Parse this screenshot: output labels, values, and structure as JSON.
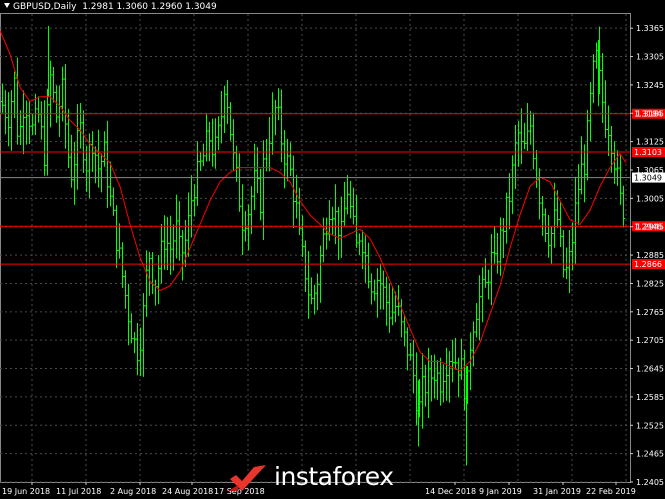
{
  "header": {
    "symbol": "GBPUSD,Daily",
    "ohlc": "1.2981 1.3060 1.2960 1.3049"
  },
  "price_axis": {
    "ticks": [
      "1.3365",
      "1.3305",
      "1.3245",
      "1.3185",
      "1.3125",
      "1.3065",
      "1.3005",
      "1.2945",
      "1.2885",
      "1.2825",
      "1.2765",
      "1.2705",
      "1.2645",
      "1.2585",
      "1.2525",
      "1.2465",
      "1.2405"
    ]
  },
  "time_axis": {
    "labels": [
      "19 Jun 2018",
      "11 Jul 2018",
      "2 Aug 2018",
      "24 Aug 2018",
      "17 Sep 2018",
      "14 Dec 2018",
      "9 Jan 2019",
      "31 Jan 2019",
      "22 Feb 2019"
    ]
  },
  "horizontal_levels": [
    {
      "price": 1.3184,
      "label": "1.3184"
    },
    {
      "price": 1.3103,
      "label": "1.3103"
    },
    {
      "price": 1.2946,
      "label": "1.2946"
    },
    {
      "price": 1.2866,
      "label": "1.2866"
    }
  ],
  "current_price": {
    "price": 1.3049,
    "label": "1.3049"
  },
  "watermark": {
    "text": "instaforex",
    "icon": "instaforex-logo-icon"
  },
  "colors": {
    "background": "#000000",
    "grid": "#4a4a4a",
    "bar": "#00ff00",
    "moving_average": "#ff0000",
    "level_line": "#ff0000",
    "level_label_bg": "#ff0000",
    "current_label_bg": "#ffffff",
    "axis_text": "#ffffff",
    "watermark_logo": "#e8362d"
  },
  "chart_data": {
    "type": "ohlc",
    "instrument": "GBPUSD",
    "timeframe": "Daily",
    "price_range": [
      1.2405,
      1.3395
    ],
    "close_path": [
      [
        0,
        1.321
      ],
      [
        8,
        1.318
      ],
      [
        14,
        1.325
      ],
      [
        18,
        1.312
      ],
      [
        24,
        1.322
      ],
      [
        32,
        1.315
      ],
      [
        38,
        1.318
      ],
      [
        44,
        1.31
      ],
      [
        50,
        1.326
      ],
      [
        56,
        1.318
      ],
      [
        62,
        1.323
      ],
      [
        66,
        1.314
      ],
      [
        70,
        1.305
      ],
      [
        76,
        1.311
      ],
      [
        80,
        1.315
      ],
      [
        86,
        1.308
      ],
      [
        92,
        1.313
      ],
      [
        98,
        1.307
      ],
      [
        104,
        1.31
      ],
      [
        110,
        1.3
      ],
      [
        116,
        1.292
      ],
      [
        122,
        1.284
      ],
      [
        128,
        1.276
      ],
      [
        134,
        1.27
      ],
      [
        138,
        1.268
      ],
      [
        144,
        1.278
      ],
      [
        148,
        1.29
      ],
      [
        154,
        1.282
      ],
      [
        158,
        1.286
      ],
      [
        164,
        1.292
      ],
      [
        170,
        1.29
      ],
      [
        176,
        1.294
      ],
      [
        180,
        1.288
      ],
      [
        186,
        1.292
      ],
      [
        192,
        1.302
      ],
      [
        198,
        1.306
      ],
      [
        204,
        1.31
      ],
      [
        208,
        1.314
      ],
      [
        214,
        1.31
      ],
      [
        220,
        1.316
      ],
      [
        224,
        1.325
      ],
      [
        228,
        1.32
      ],
      [
        232,
        1.31
      ],
      [
        238,
        1.302
      ],
      [
        242,
        1.296
      ],
      [
        248,
        1.298
      ],
      [
        254,
        1.304
      ],
      [
        260,
        1.3
      ],
      [
        264,
        1.31
      ],
      [
        270,
        1.315
      ],
      [
        276,
        1.32
      ],
      [
        280,
        1.314
      ],
      [
        284,
        1.31
      ],
      [
        290,
        1.306
      ],
      [
        296,
        1.298
      ],
      [
        300,
        1.29
      ],
      [
        306,
        1.284
      ],
      [
        310,
        1.278
      ],
      [
        316,
        1.282
      ],
      [
        320,
        1.288
      ],
      [
        326,
        1.296
      ],
      [
        330,
        1.3
      ],
      [
        336,
        1.296
      ],
      [
        342,
        1.292
      ],
      [
        346,
        1.304
      ],
      [
        350,
        1.298
      ],
      [
        356,
        1.29
      ],
      [
        360,
        1.294
      ],
      [
        366,
        1.287
      ],
      [
        372,
        1.282
      ],
      [
        378,
        1.284
      ],
      [
        384,
        1.28
      ],
      [
        390,
        1.276
      ],
      [
        396,
        1.278
      ],
      [
        402,
        1.272
      ],
      [
        408,
        1.268
      ],
      [
        414,
        1.262
      ],
      [
        418,
        1.255
      ],
      [
        422,
        1.26
      ],
      [
        428,
        1.262
      ],
      [
        434,
        1.264
      ],
      [
        440,
        1.262
      ],
      [
        444,
        1.265
      ],
      [
        450,
        1.268
      ],
      [
        456,
        1.266
      ],
      [
        462,
        1.264
      ],
      [
        466,
        1.258
      ],
      [
        470,
        1.27
      ],
      [
        474,
        1.276
      ],
      [
        480,
        1.28
      ],
      [
        486,
        1.282
      ],
      [
        490,
        1.288
      ],
      [
        494,
        1.286
      ],
      [
        500,
        1.292
      ],
      [
        504,
        1.296
      ],
      [
        510,
        1.302
      ],
      [
        514,
        1.31
      ],
      [
        518,
        1.314
      ],
      [
        522,
        1.31
      ],
      [
        526,
        1.312
      ],
      [
        530,
        1.316
      ],
      [
        536,
        1.306
      ],
      [
        540,
        1.3
      ],
      [
        546,
        1.294
      ],
      [
        550,
        1.292
      ],
      [
        556,
        1.298
      ],
      [
        560,
        1.29
      ],
      [
        564,
        1.284
      ],
      [
        568,
        1.286
      ],
      [
        572,
        1.292
      ],
      [
        576,
        1.3
      ],
      [
        580,
        1.306
      ],
      [
        584,
        1.308
      ],
      [
        588,
        1.316
      ],
      [
        592,
        1.326
      ],
      [
        596,
        1.33
      ],
      [
        600,
        1.324
      ],
      [
        604,
        1.318
      ],
      [
        608,
        1.316
      ],
      [
        612,
        1.312
      ],
      [
        616,
        1.306
      ],
      [
        620,
        1.3
      ],
      [
        624,
        1.298
      ]
    ],
    "moving_average_path": [
      [
        0,
        1.336
      ],
      [
        10,
        1.331
      ],
      [
        20,
        1.324
      ],
      [
        30,
        1.321
      ],
      [
        40,
        1.322
      ],
      [
        50,
        1.322
      ],
      [
        60,
        1.32
      ],
      [
        70,
        1.317
      ],
      [
        80,
        1.315
      ],
      [
        90,
        1.312
      ],
      [
        100,
        1.31
      ],
      [
        110,
        1.308
      ],
      [
        120,
        1.303
      ],
      [
        130,
        1.295
      ],
      [
        140,
        1.288
      ],
      [
        150,
        1.283
      ],
      [
        160,
        1.281
      ],
      [
        170,
        1.282
      ],
      [
        180,
        1.285
      ],
      [
        190,
        1.29
      ],
      [
        200,
        1.295
      ],
      [
        210,
        1.3
      ],
      [
        220,
        1.304
      ],
      [
        230,
        1.306
      ],
      [
        240,
        1.307
      ],
      [
        250,
        1.307
      ],
      [
        260,
        1.307
      ],
      [
        270,
        1.307
      ],
      [
        280,
        1.306
      ],
      [
        290,
        1.304
      ],
      [
        300,
        1.3
      ],
      [
        310,
        1.297
      ],
      [
        320,
        1.295
      ],
      [
        330,
        1.293
      ],
      [
        340,
        1.292
      ],
      [
        350,
        1.293
      ],
      [
        360,
        1.294
      ],
      [
        370,
        1.292
      ],
      [
        380,
        1.288
      ],
      [
        390,
        1.283
      ],
      [
        400,
        1.278
      ],
      [
        410,
        1.273
      ],
      [
        420,
        1.268
      ],
      [
        430,
        1.266
      ],
      [
        440,
        1.266
      ],
      [
        450,
        1.265
      ],
      [
        460,
        1.264
      ],
      [
        470,
        1.266
      ],
      [
        480,
        1.27
      ],
      [
        490,
        1.276
      ],
      [
        500,
        1.282
      ],
      [
        510,
        1.29
      ],
      [
        520,
        1.297
      ],
      [
        530,
        1.303
      ],
      [
        540,
        1.305
      ],
      [
        550,
        1.304
      ],
      [
        560,
        1.3
      ],
      [
        570,
        1.296
      ],
      [
        580,
        1.295
      ],
      [
        590,
        1.298
      ],
      [
        600,
        1.303
      ],
      [
        610,
        1.307
      ],
      [
        620,
        1.31
      ],
      [
        626,
        1.308
      ]
    ]
  }
}
